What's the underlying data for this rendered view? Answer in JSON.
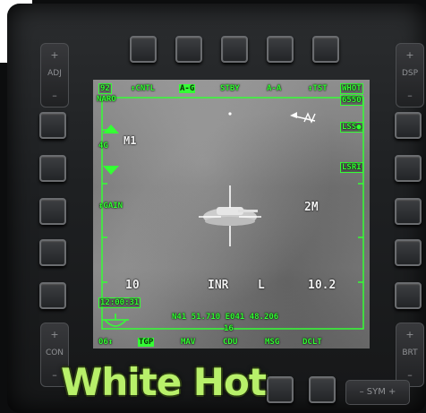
{
  "bezel": {
    "adj_label": "ADJ",
    "dsp_label": "DSP",
    "con_label": "CON",
    "brt_label": "BRT",
    "sym_label": "SYM",
    "plus": "+",
    "minus": "–"
  },
  "display": {
    "top_left_value": "92",
    "top_left_sub": "NARO",
    "osb_top": [
      "CNTL",
      "A-G",
      "STBY",
      "A-A",
      "TST"
    ],
    "top_right_mode": "WHOT",
    "top_right_value": "6550",
    "m1_label": "M1",
    "zoom_value": "4G",
    "gain_label": "GAIN",
    "right_las_label": "LSS",
    "right_lsr_label": "LSRI",
    "field_of_view": "2M",
    "bottom_left_num": "10",
    "inr_label": "INR",
    "l_label": "L",
    "range_value": "10.2",
    "time": "12:00:31",
    "coordinates": "N41 51.710 E041 48.206",
    "elevation": "16",
    "bottom_left_label": "06",
    "osb_bottom": [
      "TGP",
      "MAV",
      "CDU",
      "MSG",
      "DCLT"
    ]
  },
  "caption": "White Hot"
}
